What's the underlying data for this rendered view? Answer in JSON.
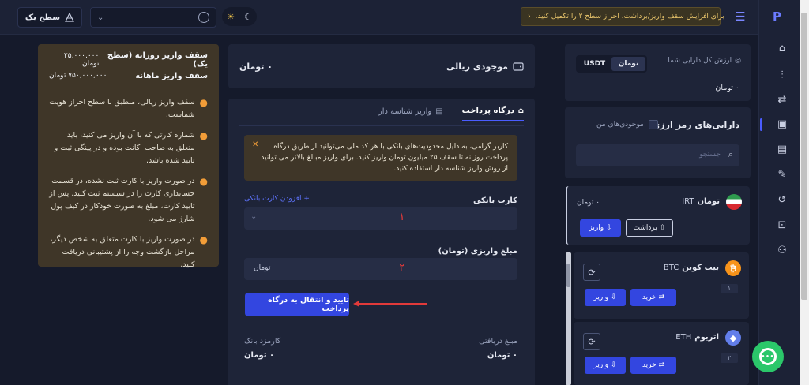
{
  "header": {
    "banner_text": "برای افزایش سقف واریز/برداشت، احراز سطح ۲ را تکمیل کنید.",
    "banner_arrow": "‹",
    "level_label": "سطح یک",
    "menu_icon": "menu-icon",
    "theme_sun": "☀",
    "theme_moon": "☾",
    "select_chevron": "⌄"
  },
  "limits": {
    "daily_label": "سقف واریز روزانه (سطح یک)",
    "daily_value": "۲۵,۰۰۰,۰۰۰ تومان",
    "monthly_label": "سقف واریز ماهانه",
    "monthly_value": "۷۵۰,۰۰۰,۰۰۰ تومان",
    "notes": [
      "سقف واریز ریالی، منطبق با سطح احراز هویت شماست.",
      "شماره کارتی که با آن واریز می کنید، باید متعلق به صاحب اکانت بوده و در پینگی ثبت و تایید شده باشد.",
      "در صورت واریز با کارت ثبت نشده، در قسمت حسابداری کارت را در سیستم ثبت کنید. پس از تایید کارت، مبلغ به صورت خودکار در کیف پول شارژ می شود.",
      "در صورت واریز با کارت متعلق به شخص دیگر، مراحل بازگشت وجه را از پشتیبانی دریافت کنید."
    ]
  },
  "rial": {
    "title": "موجودی ریالی",
    "amount": "۰ تومان"
  },
  "deposit": {
    "tab_gateway": "درگاه پرداخت",
    "tab_id_deposit": "واریز شناسه دار",
    "warning": "کاربر گرامی، به دلیل محدودیت‌های بانکی با هر کد ملی می‌توانید از طریق درگاه پرداخت روزانه تا سقف ۲۵ میلیون تومان واریز کنید. برای واریز مبالغ بالاتر می توانید از روش واریز شناسه دار استفاده کنید.",
    "close": "✕",
    "bank_card_label": "کارت بانکی",
    "add_card": "+ افزودن کارت بانکی",
    "marker_1": "۱",
    "marker_2": "۲",
    "amount_label": "مبلغ واریزی (تومان)",
    "amount_unit": "تومان",
    "submit": "تایید و انتقال به درگاه پرداخت",
    "received_label": "مبلغ دریافتی",
    "received_value": "۰ تومان",
    "fee_label": "کارمزد بانک",
    "fee_value": "۰ تومان"
  },
  "assets": {
    "title": "ارزش کل دارایی شما",
    "toman": "تومان",
    "usdt": "USDT",
    "value": "۰ تومان"
  },
  "crypto": {
    "title": "دارایی‌های رمز ارزی",
    "my_assets": "موجودی‌های من",
    "search_placeholder": "جستجو",
    "coins": [
      {
        "name": "تومان",
        "symbol": "IRT",
        "balance": "۰ تومان",
        "deposit": "واریز",
        "withdraw": "برداشت"
      },
      {
        "name": "بیت کوین",
        "symbol": "BTC",
        "badge": "۱",
        "deposit": "واریز",
        "buy": "خرید"
      },
      {
        "name": "اتریوم",
        "symbol": "ETH",
        "badge": "۲",
        "deposit": "واریز",
        "buy": "خرید"
      }
    ]
  },
  "chat": {
    "label": "•••"
  },
  "colors": {
    "accent": "#3346e0",
    "warning_bg": "#3f3628",
    "bg": "#151a2b"
  }
}
